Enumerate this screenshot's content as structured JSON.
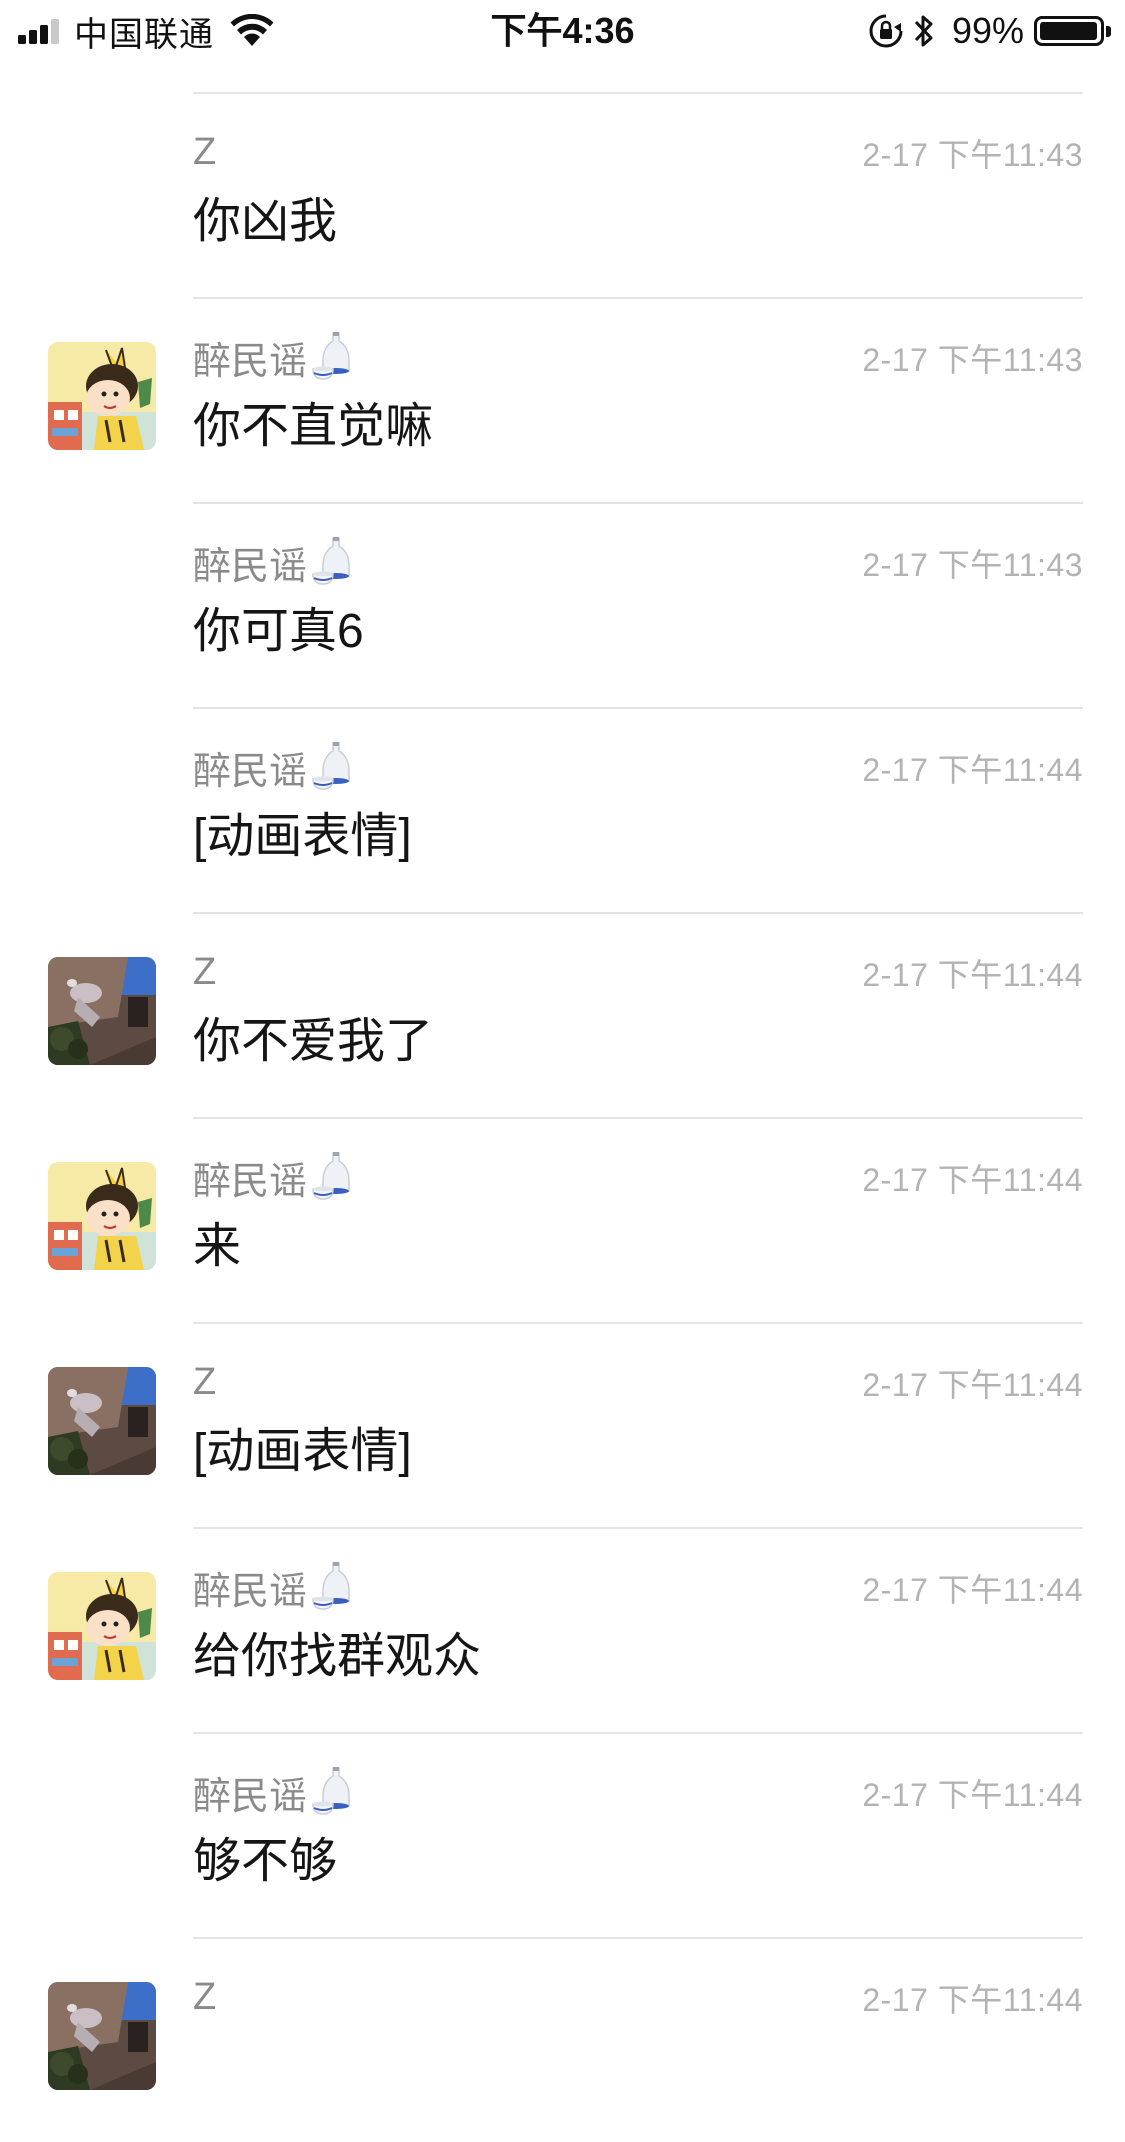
{
  "status_bar": {
    "carrier": "中国联通",
    "time": "下午4:36",
    "battery_percent": "99%",
    "battery_level": 0.99,
    "signal_bars": 3,
    "icons": [
      "signal-icon",
      "wifi-icon",
      "rotation-lock-icon",
      "bluetooth-icon",
      "battery-icon"
    ]
  },
  "colors": {
    "text_primary": "#151515",
    "text_secondary": "#8a8a8a",
    "timestamp": "#b3b3b3",
    "divider": "#e4e4e4"
  },
  "messages": [
    {
      "sender": "Z",
      "sender_icon": "",
      "avatar": "",
      "time": "2-17 下午11:43",
      "text": "你凶我"
    },
    {
      "sender": "醉民谣",
      "sender_icon": "sake-bottle-icon",
      "avatar": "cartoon-avatar",
      "time": "2-17 下午11:43",
      "text": "你不直觉嘛"
    },
    {
      "sender": "醉民谣",
      "sender_icon": "sake-bottle-icon",
      "avatar": "",
      "time": "2-17 下午11:43",
      "text": "你可真6"
    },
    {
      "sender": "醉民谣",
      "sender_icon": "sake-bottle-icon",
      "avatar": "",
      "time": "2-17 下午11:44",
      "text": "[动画表情]"
    },
    {
      "sender": "Z",
      "sender_icon": "",
      "avatar": "photo-avatar",
      "time": "2-17 下午11:44",
      "text": "你不爱我了"
    },
    {
      "sender": "醉民谣",
      "sender_icon": "sake-bottle-icon",
      "avatar": "cartoon-avatar",
      "time": "2-17 下午11:44",
      "text": "来"
    },
    {
      "sender": "Z",
      "sender_icon": "",
      "avatar": "photo-avatar",
      "time": "2-17 下午11:44",
      "text": "[动画表情]"
    },
    {
      "sender": "醉民谣",
      "sender_icon": "sake-bottle-icon",
      "avatar": "cartoon-avatar",
      "time": "2-17 下午11:44",
      "text": "给你找群观众"
    },
    {
      "sender": "醉民谣",
      "sender_icon": "sake-bottle-icon",
      "avatar": "",
      "time": "2-17 下午11:44",
      "text": "够不够"
    },
    {
      "sender": "Z",
      "sender_icon": "",
      "avatar": "photo-avatar",
      "time": "2-17 下午11:44",
      "text": ""
    }
  ]
}
